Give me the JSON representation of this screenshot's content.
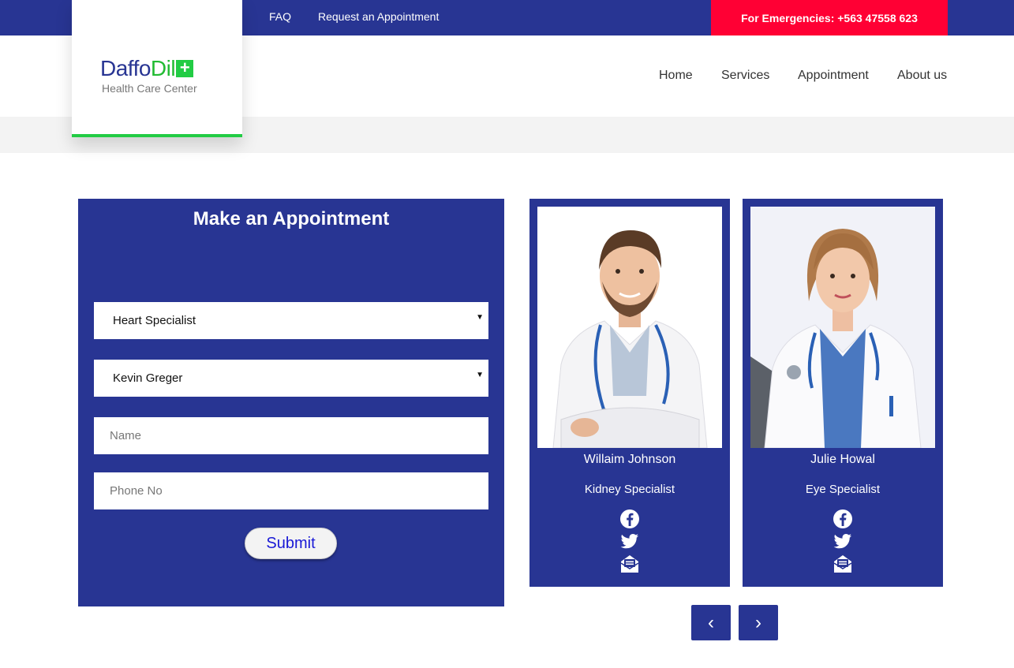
{
  "topbar": {
    "faq": "FAQ",
    "request": "Request an Appointment",
    "emergency": "For Emergencies: +563 47558 623"
  },
  "logo": {
    "part1": "Daffo",
    "part2": "Dil",
    "plus": "+",
    "subtitle": "Health Care Center"
  },
  "nav": {
    "items": [
      {
        "label": "Home"
      },
      {
        "label": "Services"
      },
      {
        "label": "Appointment"
      },
      {
        "label": "About us"
      }
    ]
  },
  "appointment": {
    "title": "Make an Appointment",
    "department_value": "Heart Specialist",
    "doctor_value": "Kevin Greger",
    "name_placeholder": "Name",
    "phone_placeholder": "Phone No",
    "submit_label": "Submit"
  },
  "doctors": [
    {
      "name": "Willaim Johnson",
      "specialty": "Kidney Specialist"
    },
    {
      "name": "Julie Howal",
      "specialty": "Eye Specialist"
    }
  ],
  "carousel": {
    "prev": "‹",
    "next": "›"
  },
  "colors": {
    "brand_navy": "#283593",
    "emergency_red": "#ff0034",
    "accent_green": "#22cc44"
  },
  "icons": [
    "facebook-icon",
    "twitter-icon",
    "mail-icon",
    "chevron-left-icon",
    "chevron-right-icon",
    "caret-down-icon"
  ]
}
